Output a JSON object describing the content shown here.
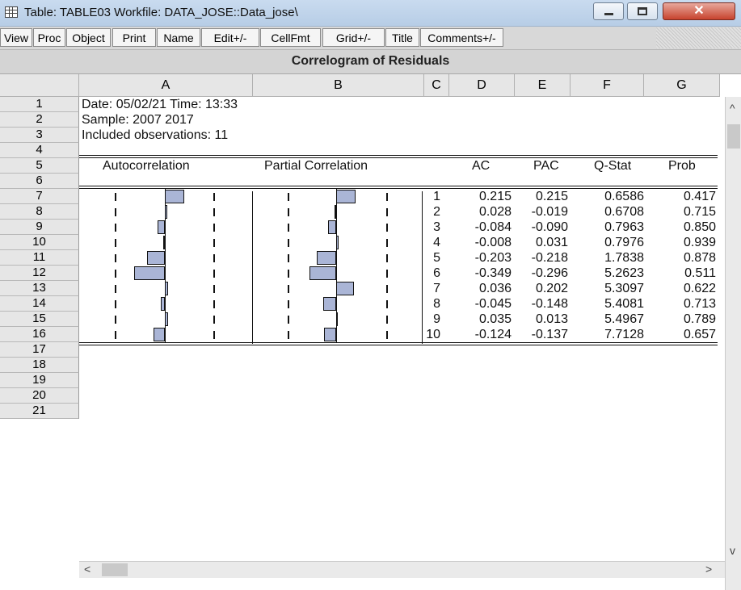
{
  "window": {
    "title": "Table: TABLE03   Workfile: DATA_JOSE::Data_jose\\",
    "min_glyph": "–",
    "max_glyph": "□",
    "close_glyph": "✕"
  },
  "toolbar": [
    "View",
    "Proc",
    "Object",
    "Print",
    "Name",
    "Edit+/-",
    "CellFmt",
    "Grid+/-",
    "Title",
    "Comments+/-"
  ],
  "table_title": "Correlogram of Residuals",
  "columns": [
    "A",
    "B",
    "C",
    "D",
    "E",
    "F",
    "G"
  ],
  "row_numbers": [
    "1",
    "2",
    "3",
    "4",
    "5",
    "6",
    "7",
    "8",
    "9",
    "10",
    "11",
    "12",
    "13",
    "14",
    "15",
    "16",
    "17",
    "18",
    "19",
    "20",
    "21"
  ],
  "header_lines": [
    "Date: 05/02/21   Time: 13:33",
    "Sample: 2007 2017",
    "Included observations: 11"
  ],
  "stat_headers": {
    "autocorrelation": "Autocorrelation",
    "partial_correlation": "Partial Correlation",
    "ac": "AC",
    "pac": "PAC",
    "qstat": "Q-Stat",
    "prob": "Prob"
  },
  "lags": [
    {
      "lag": "1",
      "ac": "0.215",
      "pac": "0.215",
      "q": "0.6586",
      "prob": "0.417"
    },
    {
      "lag": "2",
      "ac": "0.028",
      "pac": "-0.019",
      "q": "0.6708",
      "prob": "0.715"
    },
    {
      "lag": "3",
      "ac": "-0.084",
      "pac": "-0.090",
      "q": "0.7963",
      "prob": "0.850"
    },
    {
      "lag": "4",
      "ac": "-0.008",
      "pac": "0.031",
      "q": "0.7976",
      "prob": "0.939"
    },
    {
      "lag": "5",
      "ac": "-0.203",
      "pac": "-0.218",
      "q": "1.7838",
      "prob": "0.878"
    },
    {
      "lag": "6",
      "ac": "-0.349",
      "pac": "-0.296",
      "q": "5.2623",
      "prob": "0.511"
    },
    {
      "lag": "7",
      "ac": "0.036",
      "pac": "0.202",
      "q": "5.3097",
      "prob": "0.622"
    },
    {
      "lag": "8",
      "ac": "-0.045",
      "pac": "-0.148",
      "q": "5.4081",
      "prob": "0.713"
    },
    {
      "lag": "9",
      "ac": "0.035",
      "pac": "0.013",
      "q": "5.4967",
      "prob": "0.789"
    },
    {
      "lag": "10",
      "ac": "-0.124",
      "pac": "-0.137",
      "q": "7.7128",
      "prob": "0.657"
    }
  ],
  "scroll": {
    "up": "^",
    "down": "v",
    "left": "<",
    "right": ">"
  }
}
